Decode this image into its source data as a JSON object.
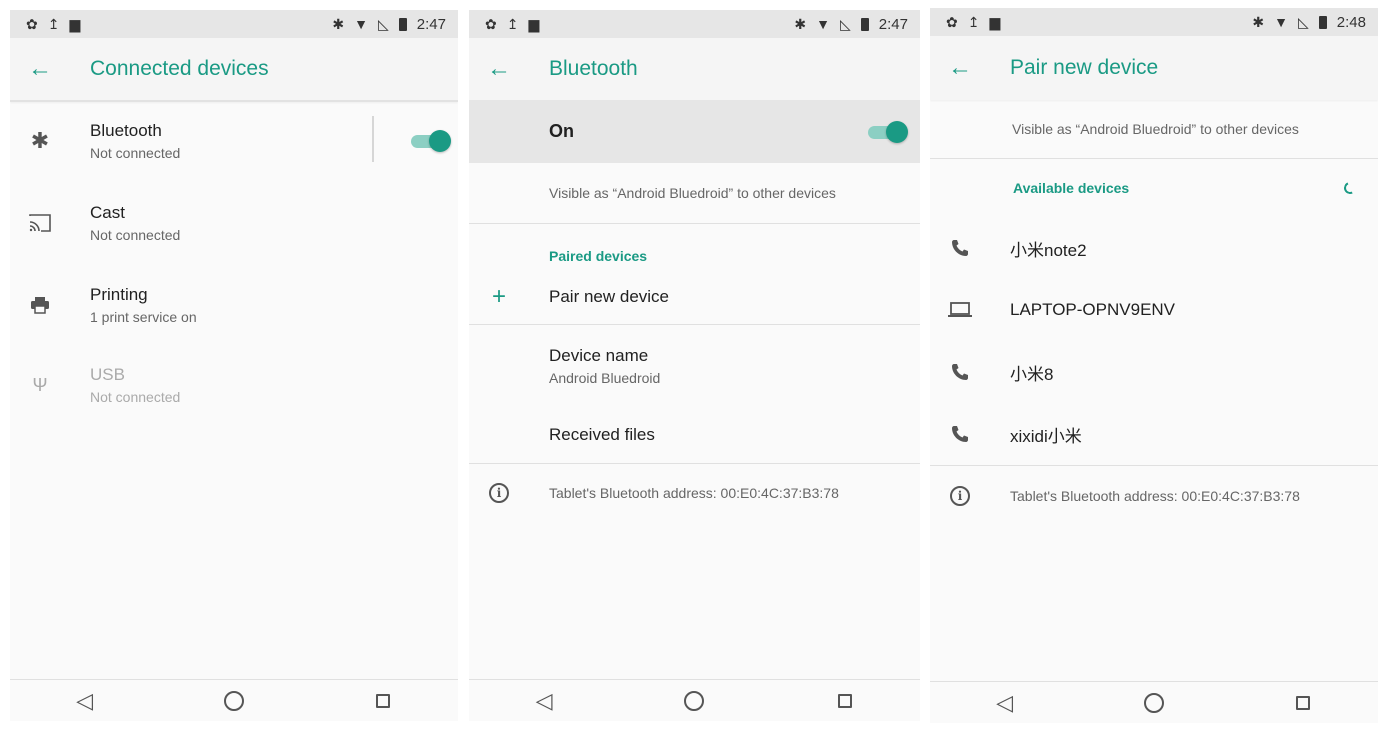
{
  "colors": {
    "accent": "#1a9a84",
    "toggle_track": "#8ccfc3",
    "statusbar": "#e6e6e6"
  },
  "screen1": {
    "status": {
      "time": "2:47"
    },
    "title": "Connected devices",
    "items": [
      {
        "icon": "bluetooth-icon",
        "title": "Bluetooth",
        "sub": "Not connected",
        "toggle_on": true
      },
      {
        "icon": "cast-icon",
        "title": "Cast",
        "sub": "Not connected"
      },
      {
        "icon": "printer-icon",
        "title": "Printing",
        "sub": "1 print service on"
      },
      {
        "icon": "usb-icon",
        "title": "USB",
        "sub": "Not connected",
        "disabled": true
      }
    ]
  },
  "screen2": {
    "status": {
      "time": "2:47"
    },
    "title": "Bluetooth",
    "on_label": "On",
    "visible_text": "Visible as “Android Bluedroid” to other devices",
    "paired_header": "Paired devices",
    "pair_new": "Pair new device",
    "device_name_title": "Device name",
    "device_name_value": "Android Bluedroid",
    "received_files": "Received files",
    "address": "Tablet's Bluetooth address: 00:E0:4C:37:B3:78"
  },
  "screen3": {
    "status": {
      "time": "2:48"
    },
    "title": "Pair new device",
    "visible_text": "Visible as “Android Bluedroid” to other devices",
    "available_header": "Available devices",
    "devices": [
      {
        "icon": "phone-icon",
        "name": "小米note2"
      },
      {
        "icon": "laptop-icon",
        "name": "LAPTOP-OPNV9ENV"
      },
      {
        "icon": "phone-icon",
        "name": "小米8"
      },
      {
        "icon": "phone-icon",
        "name": "xixidi小米"
      }
    ],
    "address": "Tablet's Bluetooth address: 00:E0:4C:37:B3:78"
  }
}
